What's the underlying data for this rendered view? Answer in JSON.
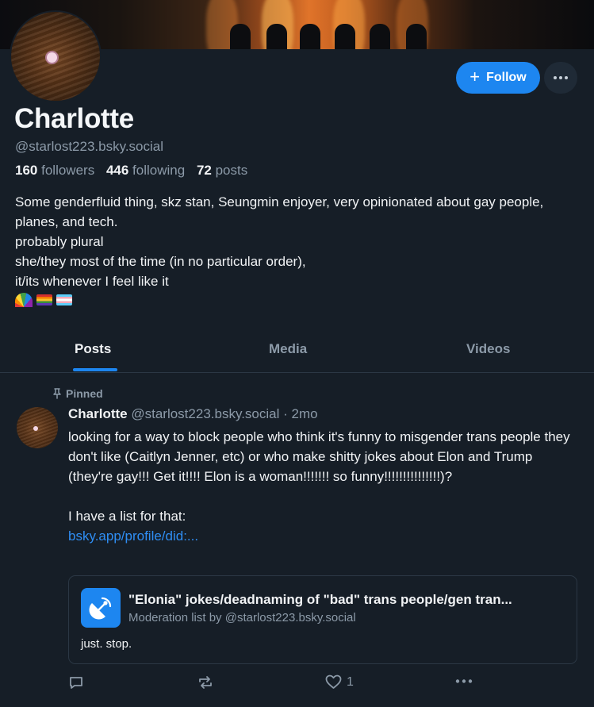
{
  "profile": {
    "name": "Charlotte",
    "handle": "@starlost223.bsky.social",
    "followers_count": "160",
    "followers_label": "followers",
    "following_count": "446",
    "following_label": "following",
    "posts_count": "72",
    "posts_label": "posts",
    "bio_lines": [
      "Some genderfluid thing, skz stan, Seungmin enjoyer, very opinionated about gay people, planes, and tech.",
      "probably plural",
      "she/they most of the time (in no particular order),",
      "it/its whenever I feel like it"
    ],
    "bio_emoji": [
      "rainbow-icon",
      "gay-pride-flag-icon",
      "trans-flag-icon"
    ]
  },
  "actions": {
    "follow_label": "Follow",
    "more_icon": "ellipsis-icon"
  },
  "tabs": [
    {
      "label": "Posts",
      "active": true
    },
    {
      "label": "Media",
      "active": false
    },
    {
      "label": "Videos",
      "active": false
    }
  ],
  "post": {
    "pinned_label": "Pinned",
    "author_name": "Charlotte",
    "author_handle": "@starlost223.bsky.social",
    "separator": "·",
    "time": "2mo",
    "text_paragraph1": "looking for a way to block people who think it's funny to misgender trans people they don't like (Caitlyn Jenner, etc) or who make shitty jokes about Elon and Trump (they're gay!!! Get it!!!! Elon is a woman!!!!!!! so funny!!!!!!!!!!!!!!!)?",
    "text_paragraph2": "I have a list for that:",
    "link_text": "bsky.app/profile/did:...",
    "embed": {
      "title": "\"Elonia\" jokes/deadnaming of \"bad\" trans people/gen tran...",
      "subtitle": "Moderation list by @starlost223.bsky.social",
      "description": "just. stop."
    },
    "like_count": "1"
  },
  "colors": {
    "background": "#161e27",
    "accent": "#1d86f0",
    "muted_text": "#8c9aa8",
    "border": "#2b3744"
  }
}
